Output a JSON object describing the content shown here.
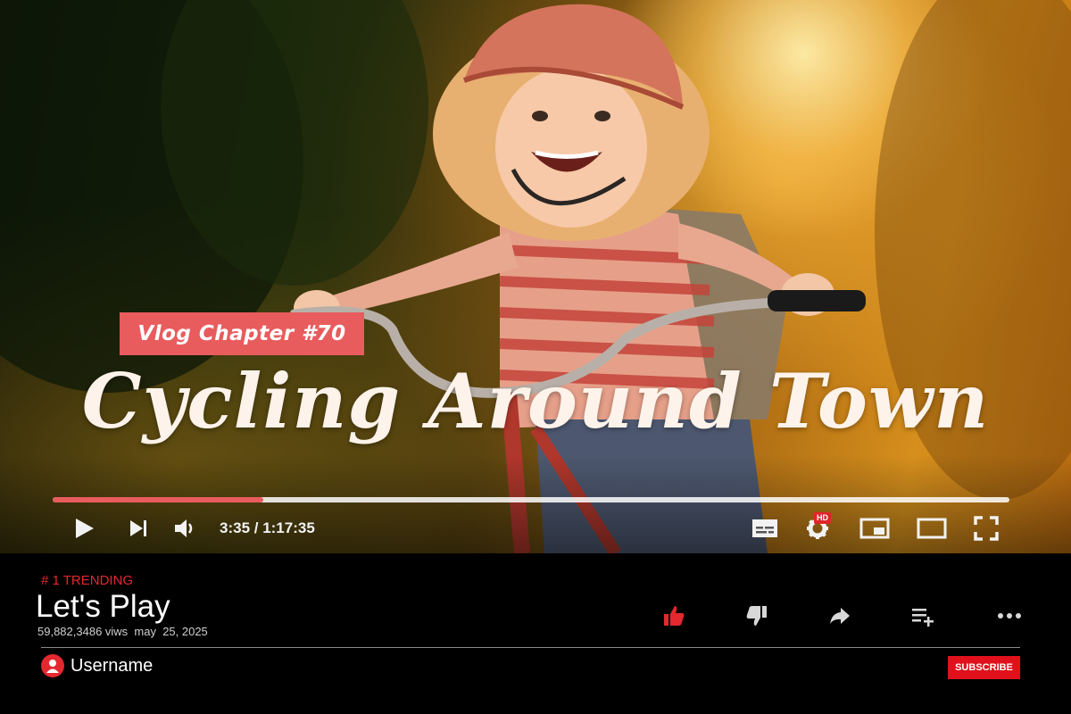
{
  "video": {
    "chapter_badge": "Vlog Chapter #70",
    "overlay_title": "Cycling Around Town",
    "progress_fraction": 0.22,
    "time": "3:35 / 1:17:35",
    "hd_label": "HD",
    "icons": [
      "play-icon",
      "skip-next-icon",
      "volume-icon",
      "captions-icon",
      "settings-icon",
      "miniplayer-icon",
      "theater-icon",
      "fullscreen-icon"
    ]
  },
  "details": {
    "trending": "# 1 TRENDING",
    "title": "Let's Play",
    "meta": "59,882,3486 viws  may  25, 2025",
    "actions": [
      "like-icon",
      "dislike-icon",
      "share-icon",
      "add-to-playlist-icon",
      "more-icon"
    ],
    "username": "Username",
    "subscribe_label": "SUBSCRIBE"
  },
  "colors": {
    "accent": "#e85c5e",
    "trending": "#e4282f",
    "subscribe": "#e0111b"
  }
}
